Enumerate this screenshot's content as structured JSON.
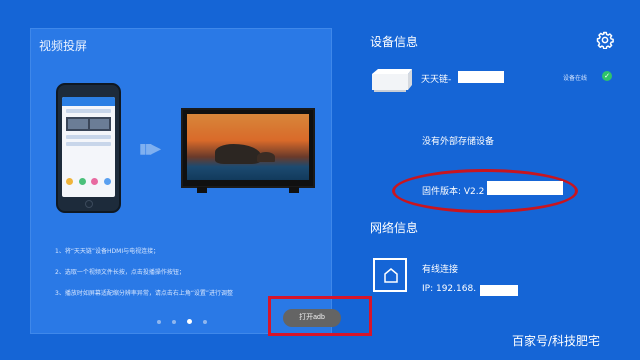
{
  "cast": {
    "title": "视频投屏",
    "steps": [
      "1、将“天天链”设备HDMI与电视连接；",
      "2、选取一个视频文件长按，点击投播操作按钮；",
      "3、播放时如屏幕适配缩分辨率异常，请点击右上角“设置”进行调整"
    ],
    "pager": {
      "pages": 4,
      "active_index": 2
    },
    "adb_button": "打开adb"
  },
  "device": {
    "title": "设备信息",
    "name": "天天链-",
    "status": "设备在线",
    "storage": "没有外部存储设备",
    "firmware": "固件版本: V2.2"
  },
  "network": {
    "title": "网络信息",
    "type": "有线连接",
    "ip": "IP: 192.168."
  },
  "icons": {
    "settings": "gear-icon",
    "device": "set-top-box-icon",
    "network": "home-network-icon",
    "status": "check-icon"
  },
  "colors": {
    "background": "#1565d6",
    "card": "#2a79e6",
    "highlight": "#d7152a",
    "status_ok": "#2fc46a"
  },
  "watermark": "百家号/科技肥宅"
}
